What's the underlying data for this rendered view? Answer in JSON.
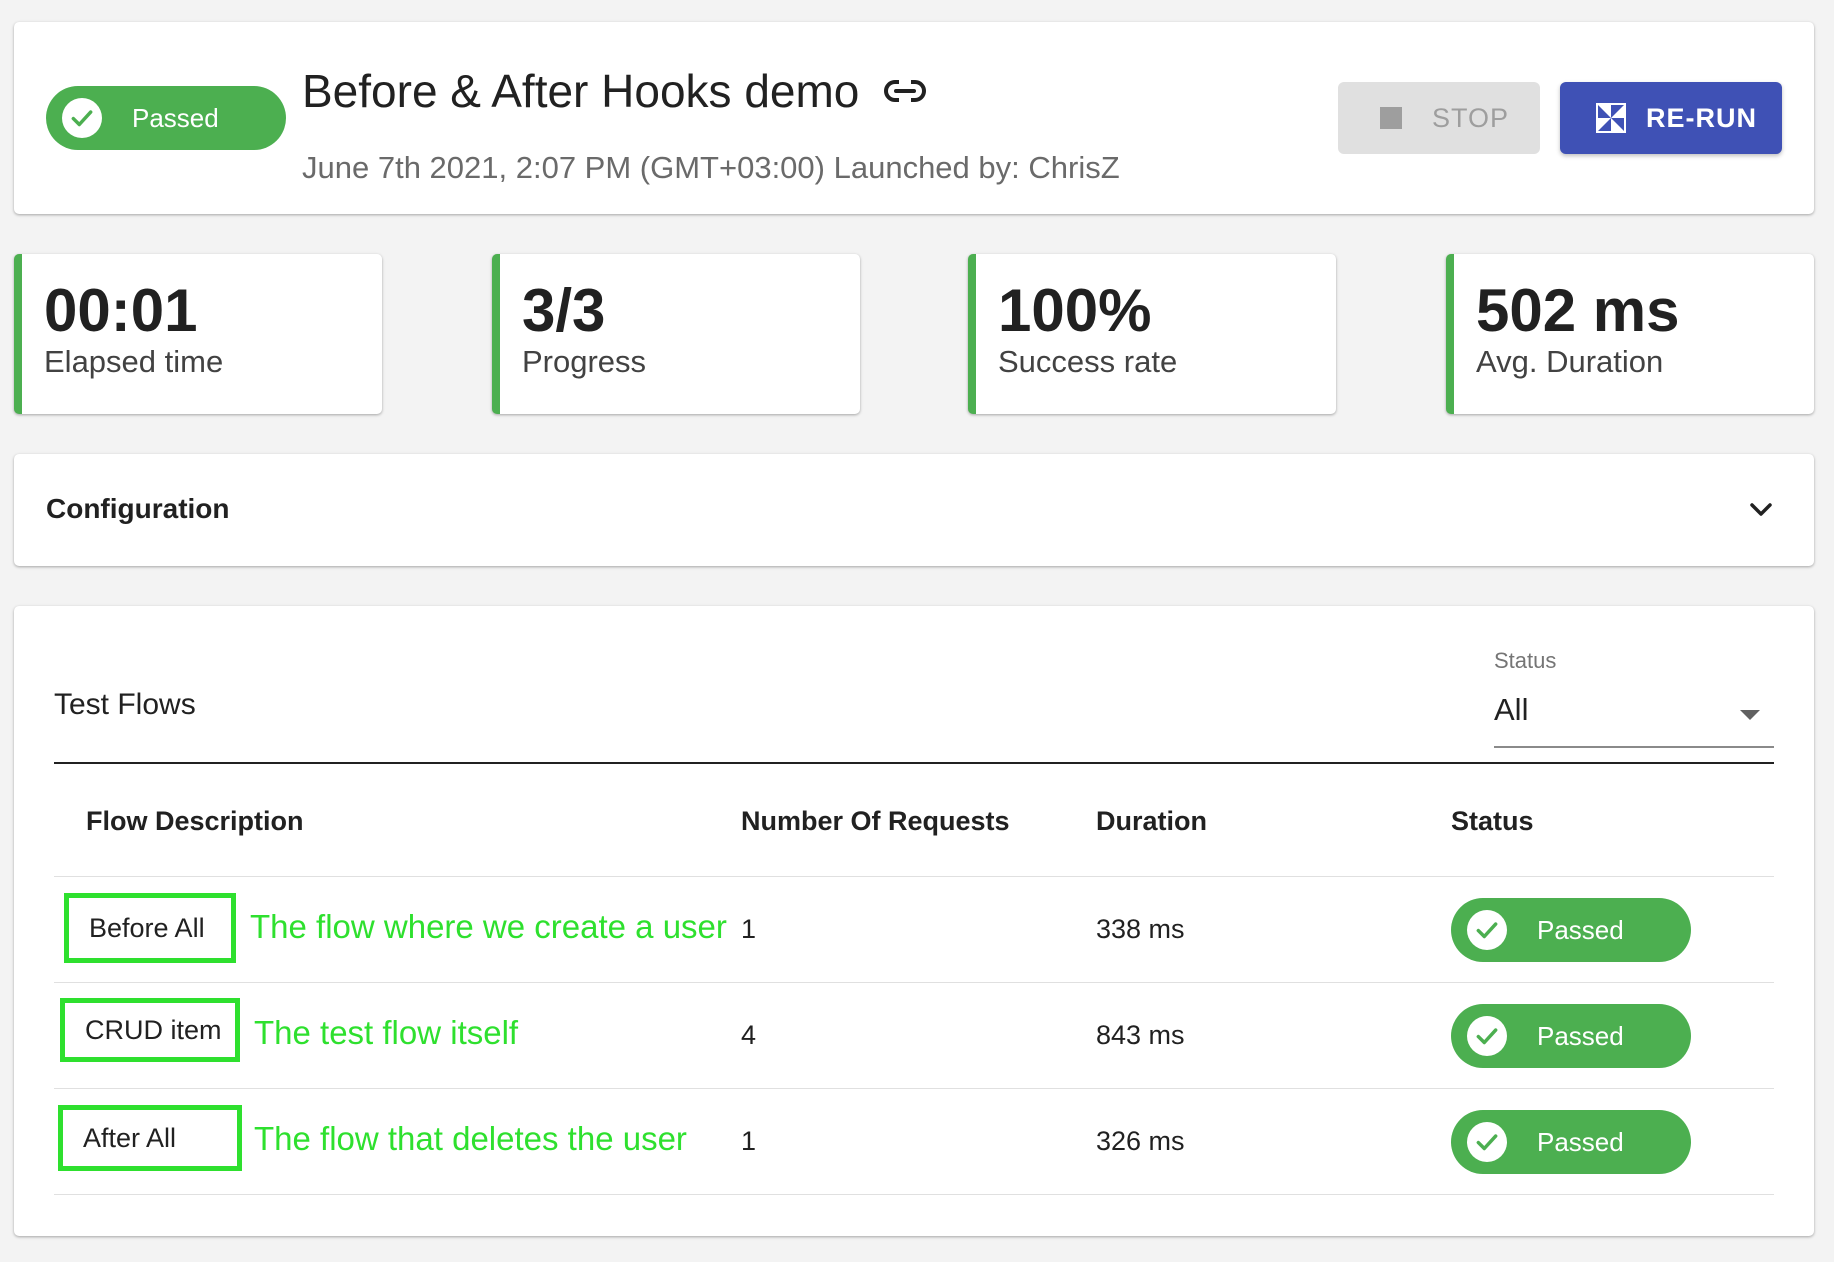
{
  "run": {
    "status": "Passed",
    "title": "Before & After Hooks demo",
    "subtitle": "June 7th 2021, 2:07 PM (GMT+03:00) Launched by: ChrisZ",
    "stop_label": "STOP",
    "rerun_label": "RE-RUN"
  },
  "stats": [
    {
      "value": "00:01",
      "label": "Elapsed time"
    },
    {
      "value": "3/3",
      "label": "Progress"
    },
    {
      "value": "100%",
      "label": "Success rate"
    },
    {
      "value": "502 ms",
      "label": "Avg. Duration"
    }
  ],
  "configuration": {
    "title": "Configuration"
  },
  "flows": {
    "title": "Test Flows",
    "filter": {
      "label": "Status",
      "value": "All"
    },
    "columns": [
      "Flow Description",
      "Number Of Requests",
      "Duration",
      "Status"
    ],
    "rows": [
      {
        "name": "Before All",
        "note": "The flow where we create a user",
        "requests": "1",
        "duration": "338 ms",
        "status": "Passed"
      },
      {
        "name": "CRUD item",
        "note": "The test flow itself",
        "requests": "4",
        "duration": "843 ms",
        "status": "Passed"
      },
      {
        "name": "After All",
        "note": "The flow that deletes the user",
        "requests": "1",
        "duration": "326 ms",
        "status": "Passed"
      }
    ]
  },
  "colors": {
    "passed": "#4caf50",
    "primary": "#3f51b5",
    "annotation": "#2ee02e"
  }
}
